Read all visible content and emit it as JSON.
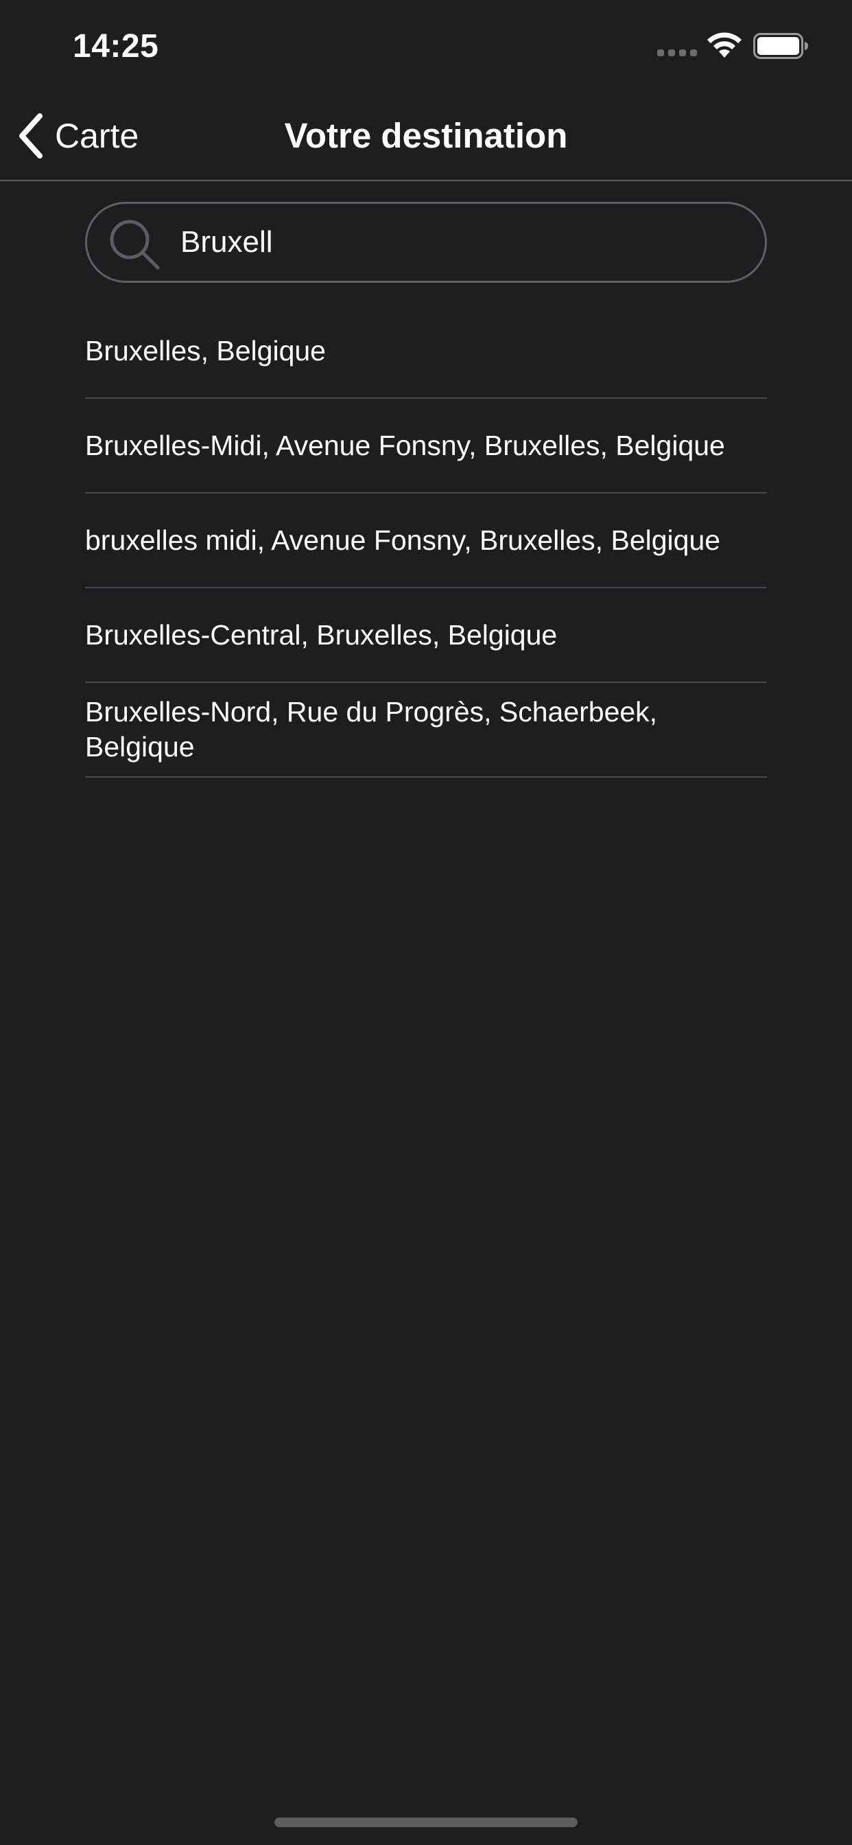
{
  "status_bar": {
    "time": "14:25",
    "icons": [
      "signal-icon",
      "wifi-icon",
      "battery-icon"
    ]
  },
  "nav": {
    "back_label": "Carte",
    "title": "Votre destination"
  },
  "search": {
    "value": "Bruxell",
    "icon": "search-icon"
  },
  "results": [
    {
      "label": "Bruxelles, Belgique"
    },
    {
      "label": "Bruxelles-Midi, Avenue Fonsny, Bruxelles, Belgique"
    },
    {
      "label": "bruxelles midi, Avenue Fonsny, Bruxelles, Belgique"
    },
    {
      "label": "Bruxelles-Central, Bruxelles, Belgique"
    },
    {
      "label": "Bruxelles-Nord, Rue du Progrès, Schaerbeek, Belgique"
    }
  ],
  "colors": {
    "background": "#1d1e20",
    "text": "#ffffff",
    "separator": "#48494d",
    "search_border": "#5f6064"
  }
}
